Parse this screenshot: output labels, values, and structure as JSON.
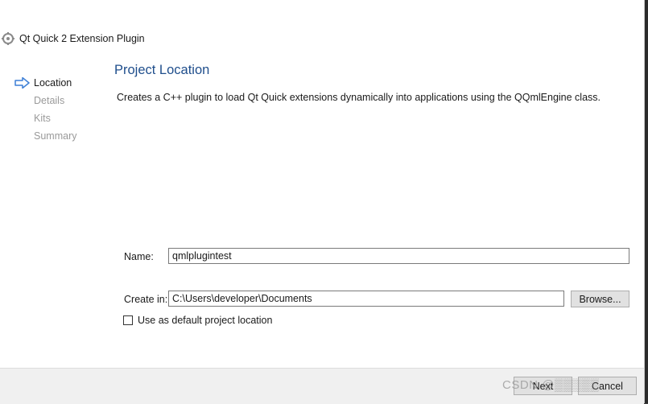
{
  "window": {
    "title": "Qt Quick 2 Extension Plugin"
  },
  "steps": [
    {
      "label": "Location",
      "active": true
    },
    {
      "label": "Details",
      "active": false
    },
    {
      "label": "Kits",
      "active": false
    },
    {
      "label": "Summary",
      "active": false
    }
  ],
  "page": {
    "title": "Project Location",
    "description": "Creates a C++ plugin to load Qt Quick extensions dynamically into applications using the QQmlEngine class."
  },
  "form": {
    "name_label": "Name:",
    "name_value": "qmlplugintest",
    "create_in_label": "Create in:",
    "create_in_value": "C:\\Users\\developer\\Documents",
    "browse_label": "Browse...",
    "default_location_label": "Use as default project location",
    "default_location_checked": false
  },
  "footer": {
    "next_label": "Next",
    "cancel_label": "Cancel"
  },
  "watermark": "CSDN @▒▒▒▒▒",
  "colors": {
    "accent": "#1f4e8c",
    "arrow": "#3d7fd6"
  }
}
